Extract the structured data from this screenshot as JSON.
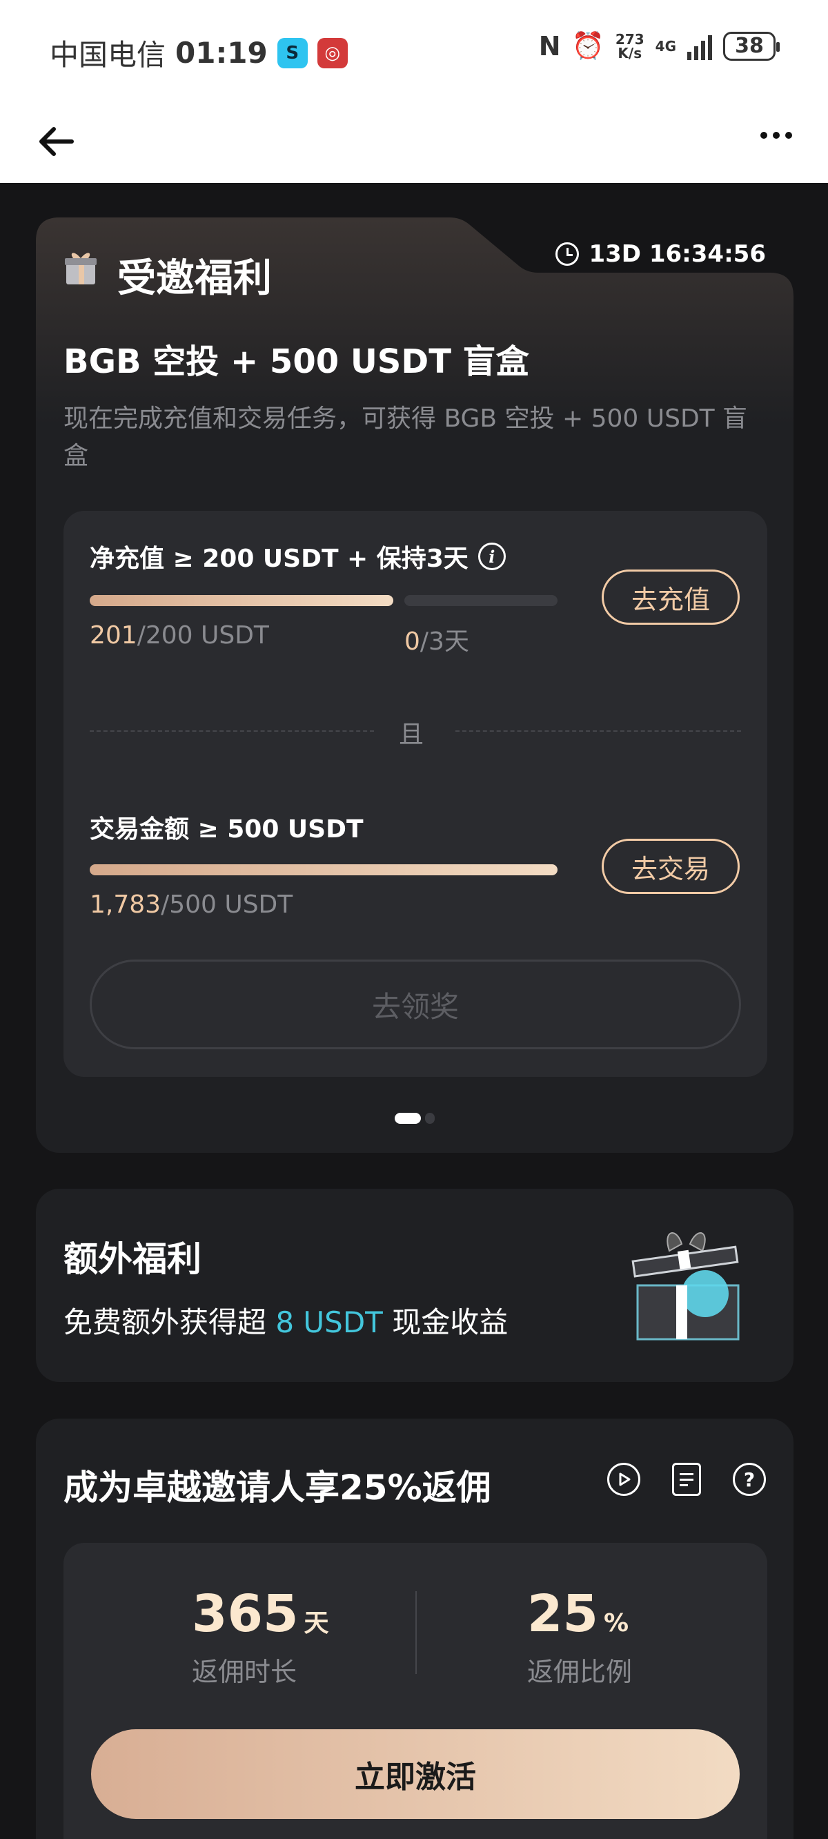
{
  "status_bar": {
    "carrier": "中国电信",
    "time": "01:19",
    "net_speed_value": "273",
    "net_speed_unit": "K/s",
    "network": "4G",
    "battery": "38"
  },
  "nav": {
    "back_icon": "arrow-left-icon",
    "more_icon": "more-horizontal-icon"
  },
  "invite": {
    "section_title": "受邀福利",
    "countdown": "13D 16:34:56",
    "reward_title": "BGB 空投 + 500 USDT 盲盒",
    "reward_desc": "现在完成充值和交易任务，可获得 BGB 空投 + 500 USDT 盲盒",
    "task1": {
      "label": "净充值 ≥ 200 USDT + 保持3天",
      "deposit_current": "201",
      "deposit_target": "/200 USDT",
      "deposit_progress": 1.0,
      "hold_current": "0",
      "hold_target": "/3天",
      "hold_progress": 0.0,
      "button": "去充值"
    },
    "connector": "且",
    "task2": {
      "label": "交易金额 ≥ 500 USDT",
      "trade_current": "1,783",
      "trade_target": "/500 USDT",
      "trade_progress": 1.0,
      "button": "去交易"
    },
    "claim_button": "去领奖",
    "pager": {
      "active": 0,
      "count": 2
    }
  },
  "extra": {
    "title": "额外福利",
    "desc_prefix": "免费额外获得超 ",
    "desc_amount": "8 USDT",
    "desc_suffix": " 现金收益"
  },
  "inviter": {
    "title": "成为卓越邀请人享25%返佣",
    "icons": [
      "play-icon",
      "document-icon",
      "help-icon"
    ],
    "duration_value": "365",
    "duration_unit": "天",
    "duration_label": "返佣时长",
    "rate_value": "25",
    "rate_unit": "%",
    "rate_label": "返佣比例",
    "activate_button": "立即激活"
  },
  "colors": {
    "background": "#151517",
    "card": "#1f2023",
    "inner_card": "#2a2b2f",
    "accent_gold": "#f2cba6",
    "accent_cyan": "#43c6dc"
  }
}
